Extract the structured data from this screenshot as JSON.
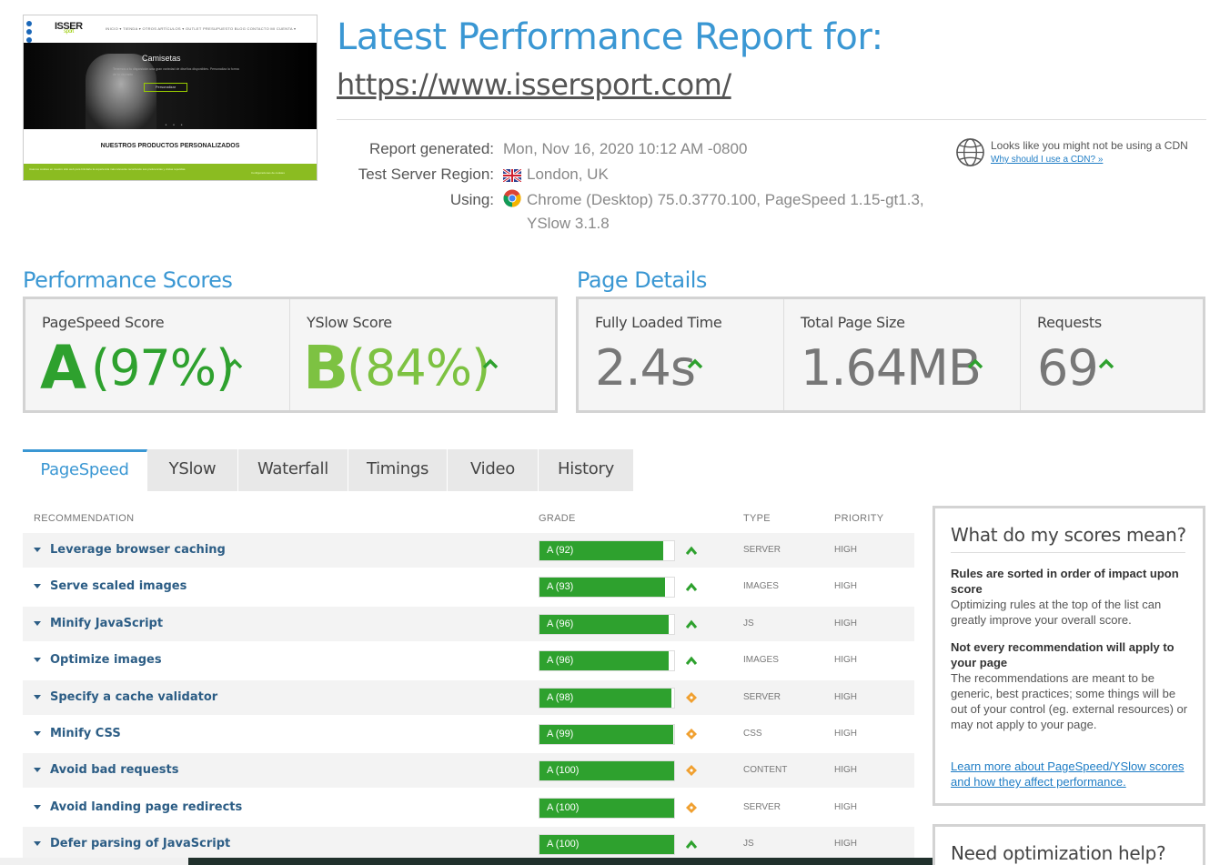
{
  "thumbnail": {
    "logo": "ISSER",
    "logo_sub": "sport",
    "menu": "INICIO ▾  TIENDA ▾  OTROS ARTÍCULOS ▾  OUTLET  PRESUPUESTO  BLOG  CONTACTO  MI CUENTA ▾",
    "hero_title": "Camisetas",
    "hero_sub": "Tenemos a tu disposición una gran variedad de diseños disponibles. Personaliza la forma de tu depósito",
    "hero_button": "Personalizar",
    "dots": "• • •",
    "products_heading": "NUESTROS PRODUCTOS PERSONALIZADOS",
    "footer_left": "Usamos cookies en nuestro sitio web para brindarle la experiencia más relevante recordando sus preferencias y visitas repetidas.",
    "footer_right": "Configuraciones de cookies"
  },
  "header": {
    "title": "Latest Performance Report for:",
    "url": "https://www.issersport.com/"
  },
  "meta": {
    "report_label": "Report generated:",
    "report_value": "Mon, Nov 16, 2020 10:12 AM -0800",
    "region_label": "Test Server Region:",
    "region_value": "London, UK",
    "using_label": "Using:",
    "using_line1": "Chrome (Desktop) 75.0.3770.100, PageSpeed 1.15-gt1.3,",
    "using_line2": "YSlow 3.1.8"
  },
  "cdn": {
    "text": "Looks like you might not be using a CDN",
    "link": "Why should I use a CDN? »"
  },
  "performance": {
    "title": "Performance Scores",
    "pagespeed_label": "PageSpeed Score",
    "pagespeed_grade": "A",
    "pagespeed_pct": "(97%)",
    "yslow_label": "YSlow Score",
    "yslow_grade": "B",
    "yslow_pct": "(84%)"
  },
  "details": {
    "title": "Page Details",
    "loaded_label": "Fully Loaded Time",
    "loaded_value": "2.4s",
    "size_label": "Total Page Size",
    "size_value": "1.64MB",
    "requests_label": "Requests",
    "requests_value": "69"
  },
  "tabs": [
    "PageSpeed",
    "YSlow",
    "Waterfall",
    "Timings",
    "Video",
    "History"
  ],
  "table": {
    "headers": {
      "recommendation": "RECOMMENDATION",
      "grade": "GRADE",
      "type": "TYPE",
      "priority": "PRIORITY"
    },
    "rows": [
      {
        "name": "Leverage browser caching",
        "grade": "A (92)",
        "score": 92,
        "trend": "up",
        "type": "SERVER",
        "priority": "HIGH"
      },
      {
        "name": "Serve scaled images",
        "grade": "A (93)",
        "score": 93,
        "trend": "up",
        "type": "IMAGES",
        "priority": "HIGH"
      },
      {
        "name": "Minify JavaScript",
        "grade": "A (96)",
        "score": 96,
        "trend": "up",
        "type": "JS",
        "priority": "HIGH"
      },
      {
        "name": "Optimize images",
        "grade": "A (96)",
        "score": 96,
        "trend": "up",
        "type": "IMAGES",
        "priority": "HIGH"
      },
      {
        "name": "Specify a cache validator",
        "grade": "A (98)",
        "score": 98,
        "trend": "same",
        "type": "SERVER",
        "priority": "HIGH"
      },
      {
        "name": "Minify CSS",
        "grade": "A (99)",
        "score": 99,
        "trend": "same",
        "type": "CSS",
        "priority": "HIGH"
      },
      {
        "name": "Avoid bad requests",
        "grade": "A (100)",
        "score": 100,
        "trend": "same",
        "type": "CONTENT",
        "priority": "HIGH"
      },
      {
        "name": "Avoid landing page redirects",
        "grade": "A (100)",
        "score": 100,
        "trend": "same",
        "type": "SERVER",
        "priority": "HIGH"
      },
      {
        "name": "Defer parsing of JavaScript",
        "grade": "A (100)",
        "score": 100,
        "trend": "up",
        "type": "JS",
        "priority": "HIGH"
      }
    ]
  },
  "sidebar": {
    "title": "What do my scores mean?",
    "p1_bold": "Rules are sorted in order of impact upon score",
    "p1_text": "Optimizing rules at the top of the list can greatly improve your overall score.",
    "p2_bold": "Not every recommendation will apply to your page",
    "p2_text": "The recommendations are meant to be generic, best practices; some things will be out of your control (eg. external resources) or may not apply to your page.",
    "link": "Learn more about PageSpeed/YSlow scores and how they affect performance.",
    "title2": "Need optimization help?"
  },
  "colors": {
    "accent": "#3a97d3",
    "grade_a": "#2ea12e",
    "grade_b": "#7dc242",
    "trend_up": "#2ea12e",
    "trend_same": "#f0a030"
  }
}
